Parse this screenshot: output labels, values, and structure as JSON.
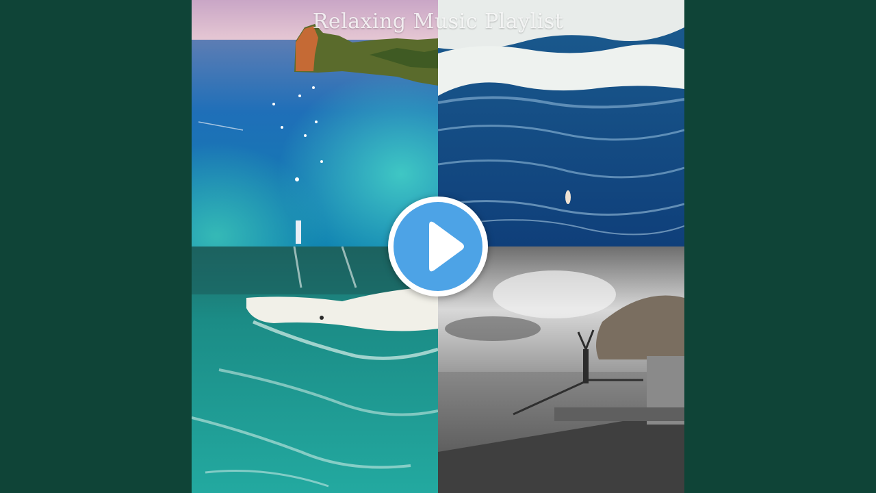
{
  "video": {
    "title": "Relaxing Music Playlist"
  },
  "player": {
    "play_icon": "play-icon",
    "play_button_color": "#4da3e6",
    "background_color": "#0f4437"
  }
}
